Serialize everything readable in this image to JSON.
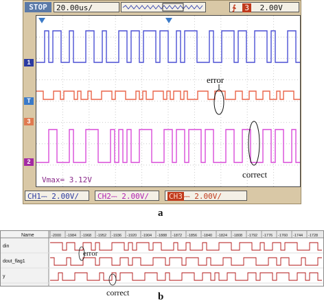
{
  "scope": {
    "status": "STOP",
    "timebase": "20.00us/",
    "trigger_source": "3",
    "trigger_level": "2.00V",
    "vmax": "Vmax= 3.12V",
    "markers": {
      "ch1": "1",
      "ch2": "2",
      "ch3": "3",
      "trig": "T"
    },
    "ch1_label": "CH1",
    "ch1_value": "2.00V/",
    "ch2_label": "CH2",
    "ch2_value": "2.00V/",
    "ch3_label": "CH3",
    "ch3_value": "2.00V/",
    "colors": {
      "ch1": "#4a4fd4",
      "ch2": "#ea6448",
      "ch3": "#d94ad9"
    },
    "annotations": {
      "error": "error",
      "correct": "correct"
    }
  },
  "caption_a": "a",
  "logic": {
    "header_name": "Name",
    "time_ticks": [
      "-2000",
      "-1984",
      "-1968",
      "-1952",
      "-1936",
      "-1920",
      "-1904",
      "-1888",
      "-1872",
      "-1856",
      "-1840",
      "-1824",
      "-1808",
      "-1792",
      "-1776",
      "-1760",
      "-1744",
      "-1728"
    ],
    "signals": [
      "din",
      "dout_flag1",
      "y"
    ],
    "annotations": {
      "error": "error",
      "correct": "correct"
    }
  },
  "caption_b": "b"
}
